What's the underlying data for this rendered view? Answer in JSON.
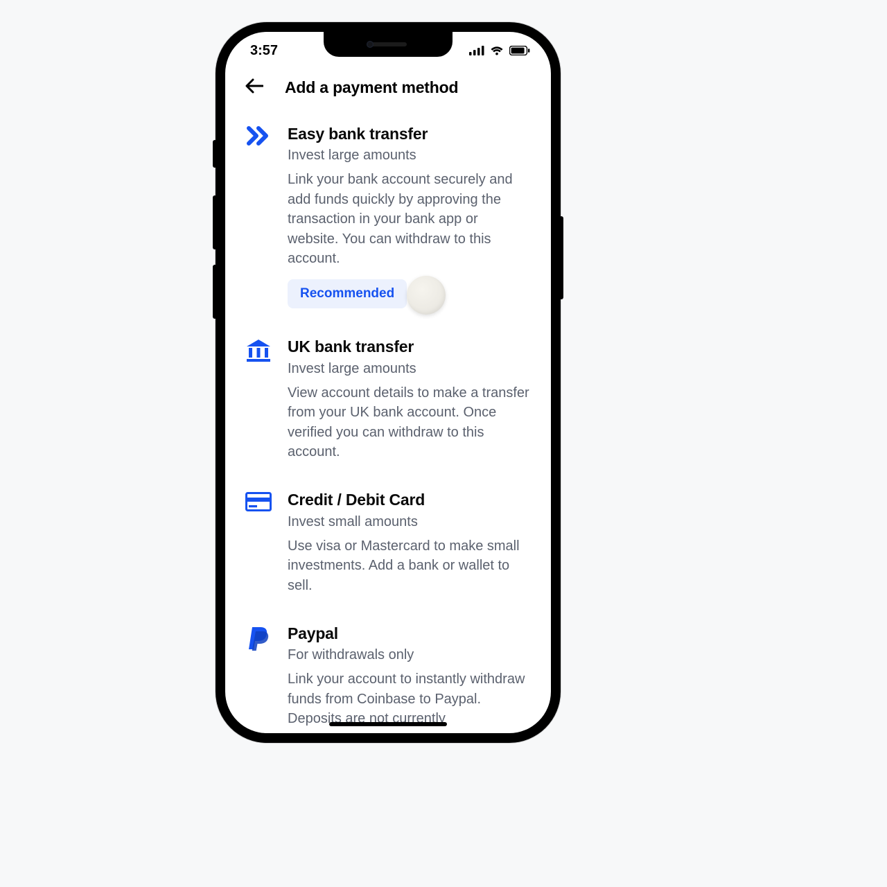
{
  "status": {
    "time": "3:57"
  },
  "header": {
    "title": "Add a payment method"
  },
  "options": [
    {
      "title": "Easy bank transfer",
      "subtitle": "Invest large amounts",
      "description": "Link your bank account securely and add funds quickly by approving the transaction in your bank app or website. You can withdraw to this account.",
      "badge": "Recommended"
    },
    {
      "title": "UK bank transfer",
      "subtitle": "Invest large amounts",
      "description": "View account details to make a transfer from your UK bank account. Once verified you can withdraw to this account."
    },
    {
      "title": "Credit / Debit Card",
      "subtitle": "Invest small amounts",
      "description": "Use visa or Mastercard to make small investments. Add a bank or wallet to sell."
    },
    {
      "title": "Paypal",
      "subtitle": "For withdrawals only",
      "description": "Link your account to instantly withdraw funds from Coinbase to Paypal. Deposits are not currently"
    }
  ],
  "colors": {
    "brand_blue": "#1652F0"
  }
}
